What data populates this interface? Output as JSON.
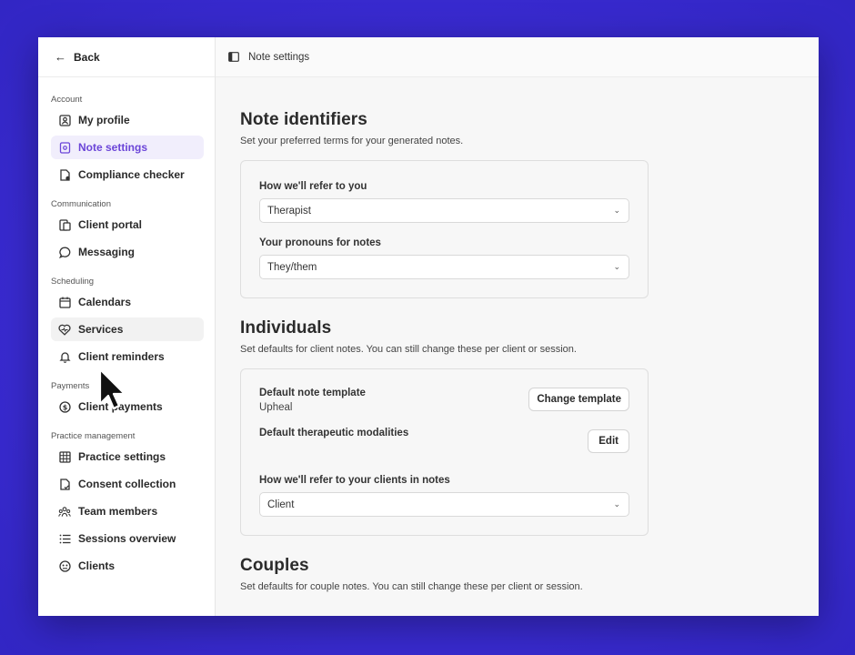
{
  "sidebar": {
    "back_label": "Back",
    "groups": [
      {
        "title": "Account",
        "items": [
          {
            "label": "My profile",
            "icon": "profile-icon"
          },
          {
            "label": "Note settings",
            "icon": "note-settings-icon",
            "active": true
          },
          {
            "label": "Compliance checker",
            "icon": "compliance-icon"
          }
        ]
      },
      {
        "title": "Communication",
        "items": [
          {
            "label": "Client portal",
            "icon": "portal-icon"
          },
          {
            "label": "Messaging",
            "icon": "message-icon"
          }
        ]
      },
      {
        "title": "Scheduling",
        "items": [
          {
            "label": "Calendars",
            "icon": "calendar-icon"
          },
          {
            "label": "Services",
            "icon": "services-icon"
          },
          {
            "label": "Client reminders",
            "icon": "bell-icon"
          }
        ]
      },
      {
        "title": "Payments",
        "items": [
          {
            "label": "Client payments",
            "icon": "dollar-icon"
          }
        ]
      },
      {
        "title": "Practice management",
        "items": [
          {
            "label": "Practice settings",
            "icon": "grid-icon"
          },
          {
            "label": "Consent collection",
            "icon": "consent-icon"
          },
          {
            "label": "Team members",
            "icon": "team-icon"
          },
          {
            "label": "Sessions overview",
            "icon": "list-icon"
          },
          {
            "label": "Clients",
            "icon": "clients-icon"
          }
        ]
      }
    ]
  },
  "header": {
    "title": "Note settings"
  },
  "identifiers": {
    "title": "Note identifiers",
    "subtitle": "Set your preferred terms for your generated notes.",
    "refer_label": "How we'll refer to you",
    "refer_value": "Therapist",
    "pronouns_label": "Your pronouns for notes",
    "pronouns_value": "They/them"
  },
  "individuals": {
    "title": "Individuals",
    "subtitle": "Set defaults for client notes. You can still change these per client or session.",
    "template_label": "Default note template",
    "template_value": "Upheal",
    "change_template_label": "Change template",
    "modalities_label": "Default therapeutic modalities",
    "edit_label": "Edit",
    "clients_label": "How we'll refer to your clients in notes",
    "clients_value": "Client"
  },
  "couples": {
    "title": "Couples",
    "subtitle": "Set defaults for couple notes. You can still change these per client or session."
  },
  "colors": {
    "accent": "#6b45d8",
    "background": "#3b2fd6"
  }
}
